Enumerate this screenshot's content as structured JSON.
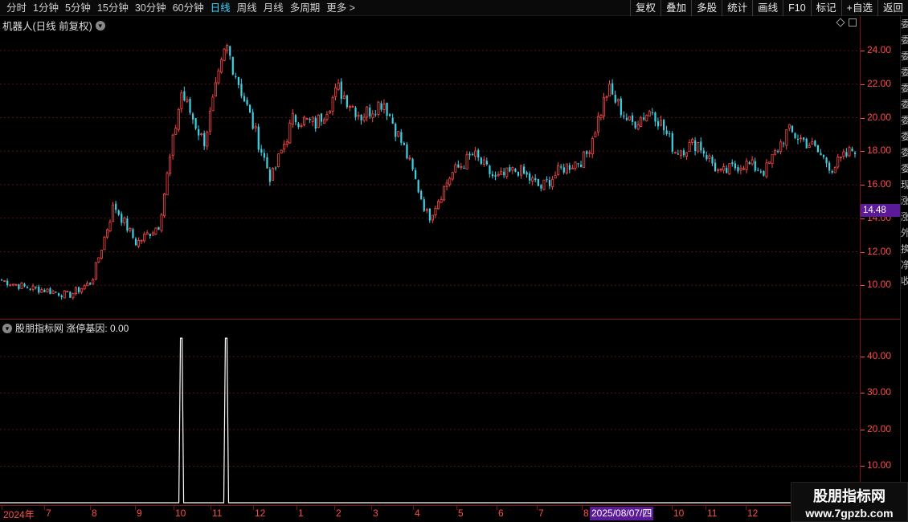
{
  "toolbar": {
    "periods": [
      "分时",
      "1分钟",
      "5分钟",
      "15分钟",
      "30分钟",
      "60分钟",
      "日线",
      "周线",
      "月线",
      "多周期",
      "更多 >"
    ],
    "active_period": "日线",
    "tools": [
      "复权",
      "叠加",
      "多股",
      "统计",
      "画线",
      "F10",
      "标记",
      "+自选",
      "返回"
    ]
  },
  "main_chart": {
    "title": "机器人(日线 前复权)",
    "current_price": "14.48",
    "colors": {
      "up": "#ff4646",
      "down": "#3cd2e6",
      "grid": "#5a1010",
      "axis_text": "#ff4b4b",
      "tag_bg": "#5a1a9a"
    }
  },
  "indicator": {
    "title": "股朋指标网 涨停基因: 0.00"
  },
  "date_axis": {
    "labels": [
      "2024年",
      "7",
      "8",
      "9",
      "10",
      "11",
      "12",
      "1",
      "2",
      "3",
      "4",
      "5",
      "6",
      "7",
      "8",
      "10",
      "11",
      "12"
    ],
    "cursor_date": "2025/08/07/四"
  },
  "right_strip": [
    "委",
    "委",
    "委",
    "委",
    "委",
    "委",
    "委",
    "委",
    "委",
    "委",
    "现",
    "涨",
    "涨",
    "外",
    "换",
    "净",
    "收"
  ],
  "watermark": {
    "title": "股朋指标网",
    "url": "www.7gpzb.com"
  },
  "chart_data": [
    {
      "type": "candlestick",
      "title": "机器人(日线 前复权)",
      "ylim": [
        8.0,
        25.2
      ],
      "y_ticks": [
        "10.00",
        "12.00",
        "14.00",
        "16.00",
        "18.00",
        "20.00",
        "22.00",
        "24.00"
      ],
      "y_tick_values": [
        10,
        12,
        14,
        16,
        18,
        20,
        22,
        24
      ],
      "close_anchors": [
        {
          "x": "2024-06",
          "close": 10.3
        },
        {
          "x": "2024-07",
          "close": 9.9
        },
        {
          "x": "2024-08",
          "close": 9.7
        },
        {
          "x": "2024-09",
          "close": 9.4
        },
        {
          "x": "2024-09-末",
          "close": 10.2
        },
        {
          "x": "2024-10",
          "close": 14.8
        },
        {
          "x": "2024-10-中",
          "close": 12.5
        },
        {
          "x": "2024-10-末",
          "close": 13.6
        },
        {
          "x": "2024-11",
          "close": 21.5
        },
        {
          "x": "2024-11-中",
          "close": 18.5
        },
        {
          "x": "2024-12",
          "close": 24.3
        },
        {
          "x": "2024-12-中",
          "close": 20.3
        },
        {
          "x": "2025-01",
          "close": 16.3
        },
        {
          "x": "2025-01-中",
          "close": 20.0
        },
        {
          "x": "2025-02",
          "close": 19.6
        },
        {
          "x": "2025-02-中",
          "close": 21.7
        },
        {
          "x": "2025-03",
          "close": 20.1
        },
        {
          "x": "2025-03-中",
          "close": 21.0
        },
        {
          "x": "2025-03-末",
          "close": 17.9
        },
        {
          "x": "2025-04",
          "close": 14.0
        },
        {
          "x": "2025-04-中",
          "close": 16.6
        },
        {
          "x": "2025-05",
          "close": 17.8
        },
        {
          "x": "2025-05-中",
          "close": 16.3
        },
        {
          "x": "2025-06",
          "close": 16.9
        },
        {
          "x": "2025-06-中",
          "close": 15.8
        },
        {
          "x": "2025-07",
          "close": 17.0
        },
        {
          "x": "2025-07-末",
          "close": 17.6
        },
        {
          "x": "2025-08",
          "close": 21.7
        },
        {
          "x": "2025-08-中",
          "close": 19.6
        },
        {
          "x": "2025-09",
          "close": 20.5
        },
        {
          "x": "2025-09-中",
          "close": 18.0
        },
        {
          "x": "2025-10",
          "close": 18.5
        },
        {
          "x": "2025-10-中",
          "close": 16.6
        },
        {
          "x": "2025-11",
          "close": 17.3
        },
        {
          "x": "2025-11-中",
          "close": 16.8
        },
        {
          "x": "2025-12",
          "close": 19.2
        },
        {
          "x": "2025-12-中",
          "close": 18.4
        },
        {
          "x": "2025-12-末",
          "close": 17.0
        },
        {
          "x": "2026-01",
          "close": 18.2
        }
      ]
    },
    {
      "type": "line",
      "title": "股朋指标网 涨停基因: 0.00",
      "series_name": "涨停基因",
      "ylim": [
        0,
        47
      ],
      "y_ticks": [
        "10.00",
        "20.00",
        "30.00",
        "40.00"
      ],
      "y_tick_values": [
        10,
        20,
        30,
        40
      ],
      "spikes": [
        {
          "x": "2024-11",
          "value": 45
        },
        {
          "x": "2024-12",
          "value": 45
        }
      ],
      "baseline": 0
    }
  ]
}
